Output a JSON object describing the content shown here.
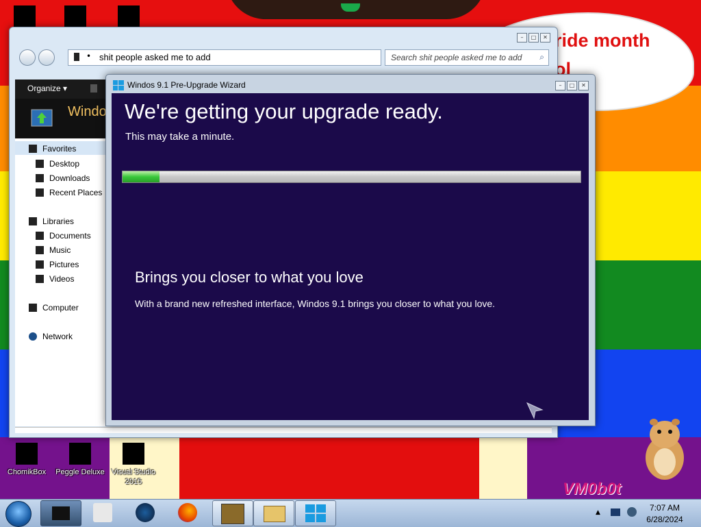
{
  "desktop": {
    "banner_text_line1": "ride month",
    "banner_text_line2": "ol",
    "watermark": "VM0b0t",
    "icons": [
      {
        "label": "ChomikBox"
      },
      {
        "label": "Peggle Deluxe"
      },
      {
        "label": "Visual Studio 2015"
      }
    ]
  },
  "explorer": {
    "address_path": "shit people asked me to add",
    "search_placeholder": "Search shit people asked me to add",
    "organize_label": "Organize",
    "banner_title": "Windo",
    "nav": {
      "favorites": "Favorites",
      "desktop": "Desktop",
      "downloads": "Downloads",
      "recent_places": "Recent Places",
      "libraries": "Libraries",
      "documents": "Documents",
      "music": "Music",
      "pictures": "Pictures",
      "videos": "Videos",
      "computer": "Computer",
      "network": "Network"
    }
  },
  "wizard": {
    "title": "Windos 9.1 Pre-Upgrade Wizard",
    "heading": "We're getting your upgrade ready.",
    "subheading": "This may take a minute.",
    "progress": 0.08,
    "feature_title": "Brings you closer to what you love",
    "feature_text": "With a brand new refreshed interface, Windos 9.1 brings you closer to what you love."
  },
  "taskbar": {
    "time": "7:07 AM",
    "date": "6/28/2024"
  },
  "colors": {
    "wizard_background": "#1b0a4a",
    "progress_fill": "#39c83a",
    "taskbar": "#b4c8e0"
  }
}
